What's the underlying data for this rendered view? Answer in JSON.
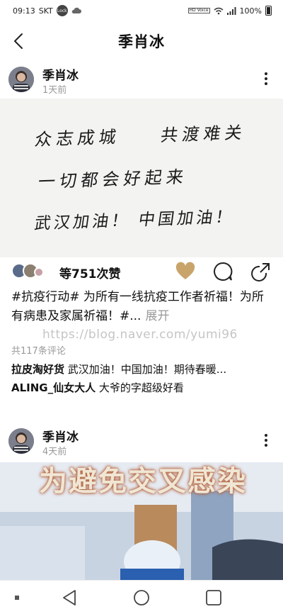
{
  "status_bar": {
    "time": "09:13",
    "carrier": "SKT",
    "lock_badge": "Lock",
    "hd_badge": "HD Voice",
    "battery": "100%"
  },
  "header": {
    "title": "季肖冰"
  },
  "posts": [
    {
      "author": "季肖冰",
      "time": "1天前",
      "handwriting": [
        "众志成城",
        "共渡难关",
        "一切都会好起来",
        "武汉加油！ 中国加油！"
      ],
      "likes": "等751次赞",
      "caption": "#抗疫行动# 为所有一线抗疫工作者祈福！为所有病患及家属祈福！#...",
      "expand": "展开",
      "comment_count": "共117条评论",
      "comments": [
        {
          "user": "拉皮淘好货",
          "text": "武汉加油！中国加油！期待春暖..."
        },
        {
          "user": "ALING_仙女大人",
          "text": "大爷的字超级好看"
        }
      ]
    },
    {
      "author": "季肖冰",
      "time": "4天前",
      "overlay": "为避免交叉感染"
    }
  ],
  "watermark": "https://blog.naver.com/yumi96",
  "colors": {
    "like_heart": "#c9a46a",
    "muted": "#9a9a9a"
  },
  "icons": [
    "back-arrow-icon",
    "more-vertical-icon",
    "heart-icon",
    "comment-icon",
    "share-icon",
    "recent-apps-icon",
    "home-icon",
    "back-icon",
    "menu-dot-icon"
  ]
}
